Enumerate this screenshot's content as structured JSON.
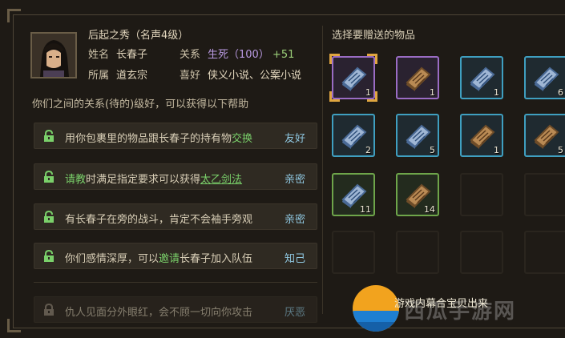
{
  "character": {
    "title": "后起之秀（名声4级）",
    "name_label": "姓名",
    "name_value": "长春子",
    "relation_label": "关系",
    "relation_value": "生死（100）",
    "relation_bonus": "+51",
    "faction_label": "所属",
    "faction_value": "道玄宗",
    "hobby_label": "喜好",
    "hobby_value": "侠义小说、公案小说"
  },
  "description": "你们之间的关系(待的)级好，可以获得以下帮助",
  "perks": [
    {
      "pre": "用你包裹里的物品跟长春子的持有物",
      "hl": "交换",
      "post": "",
      "tag": "友好"
    },
    {
      "pre": "",
      "hl": "请教",
      "mid": "时满足指定要求可以获得",
      "hl2": "太乙剑法",
      "tag": "亲密"
    },
    {
      "pre": "有长春子在旁的战斗，肯定不会袖手旁观",
      "tag": "亲密"
    },
    {
      "pre": "你们感情深厚，可以",
      "hl": "邀请",
      "post": "长春子加入队伍",
      "tag": "知己"
    },
    {
      "pre": "仇人见面分外眼红，会不顾一切向你攻击",
      "tag": "厌恶"
    }
  ],
  "gifts": {
    "title": "选择要赠送的物品",
    "slots": [
      {
        "rarity": "purple",
        "book": "blue",
        "count": "1",
        "selected": true
      },
      {
        "rarity": "purple",
        "book": "brown",
        "count": "1"
      },
      {
        "rarity": "blue",
        "book": "blue",
        "count": "1"
      },
      {
        "rarity": "blue",
        "book": "blue",
        "count": "6"
      },
      {
        "rarity": "blue",
        "book": "blue",
        "count": "2"
      },
      {
        "rarity": "blue",
        "book": "blue",
        "count": "5"
      },
      {
        "rarity": "blue",
        "book": "brown",
        "count": "1"
      },
      {
        "rarity": "blue",
        "book": "brown",
        "count": "5"
      },
      {
        "rarity": "green",
        "book": "blue",
        "count": "11"
      },
      {
        "rarity": "green",
        "book": "brown",
        "count": "14"
      }
    ]
  },
  "watermark": {
    "caption": "游戏内幕合宝贝出来",
    "brand": "西瓜手游网"
  },
  "colors": {
    "accent_green": "#7ad06a",
    "tag_blue": "#8fc7e0",
    "relation_purple": "#b99ae2",
    "select_gold": "#e0a640"
  }
}
